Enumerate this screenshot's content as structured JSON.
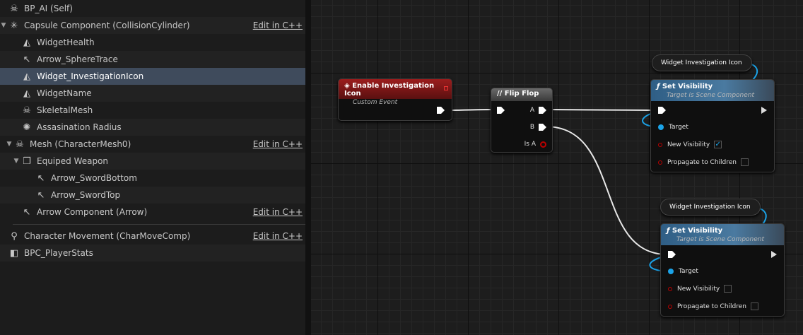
{
  "tree": {
    "items": [
      {
        "label": "BP_AI (Self)",
        "icon": "skull-actor-icon",
        "edit": ""
      },
      {
        "label": "Capsule Component (CollisionCylinder)",
        "icon": "capsule-icon",
        "edit": "Edit in C++"
      },
      {
        "label": "WidgetHealth",
        "icon": "widget-icon",
        "edit": ""
      },
      {
        "label": "Arrow_SphereTrace",
        "icon": "arrow-icon",
        "edit": ""
      },
      {
        "label": "Widget_InvestigationIcon",
        "icon": "widget-icon",
        "edit": ""
      },
      {
        "label": "WidgetName",
        "icon": "widget-icon",
        "edit": ""
      },
      {
        "label": "SkeletalMesh",
        "icon": "skeleton-icon",
        "edit": ""
      },
      {
        "label": "Assasination Radius",
        "icon": "sphere-icon",
        "edit": ""
      },
      {
        "label": "Mesh (CharacterMesh0)",
        "icon": "skeleton-icon",
        "edit": "Edit in C++"
      },
      {
        "label": "Equiped  Weapon",
        "icon": "static-mesh-icon",
        "edit": ""
      },
      {
        "label": "Arrow_SwordBottom",
        "icon": "arrow-icon",
        "edit": ""
      },
      {
        "label": "Arrow_SwordTop",
        "icon": "arrow-icon",
        "edit": ""
      },
      {
        "label": "Arrow Component (Arrow)",
        "icon": "arrow-icon",
        "edit": "Edit in C++"
      },
      {
        "label": "Character Movement (CharMoveComp)",
        "icon": "movement-icon",
        "edit": "Edit in C++"
      },
      {
        "label": "BPC_PlayerStats",
        "icon": "actor-component-icon",
        "edit": ""
      }
    ]
  },
  "graph": {
    "event_node": {
      "title": "Enable Investigation Icon",
      "subtitle": "Custom Event"
    },
    "flipflop_node": {
      "title": "Flip Flop",
      "pin_a": "A",
      "pin_b": "B",
      "pin_isa": "Is A"
    },
    "set_vis_1": {
      "title": "Set Visibility",
      "subtitle": "Target is Scene Component",
      "target": "Target",
      "new_visibility": "New Visibility",
      "propagate": "Propagate to Children",
      "new_visibility_checked": true
    },
    "set_vis_2": {
      "title": "Set Visibility",
      "subtitle": "Target is Scene Component",
      "target": "Target",
      "new_visibility": "New Visibility",
      "propagate": "Propagate to Children",
      "new_visibility_checked": false
    },
    "var_1": {
      "label": "Widget Investigation Icon"
    },
    "var_2": {
      "label": "Widget Investigation Icon"
    },
    "colors": {
      "event_header": "#8e1a1a",
      "function_header": "#3a6b8f",
      "exec_wire": "#ffffff",
      "object_pin": "#1ba3e8",
      "bool_pin": "#8b0000"
    }
  }
}
